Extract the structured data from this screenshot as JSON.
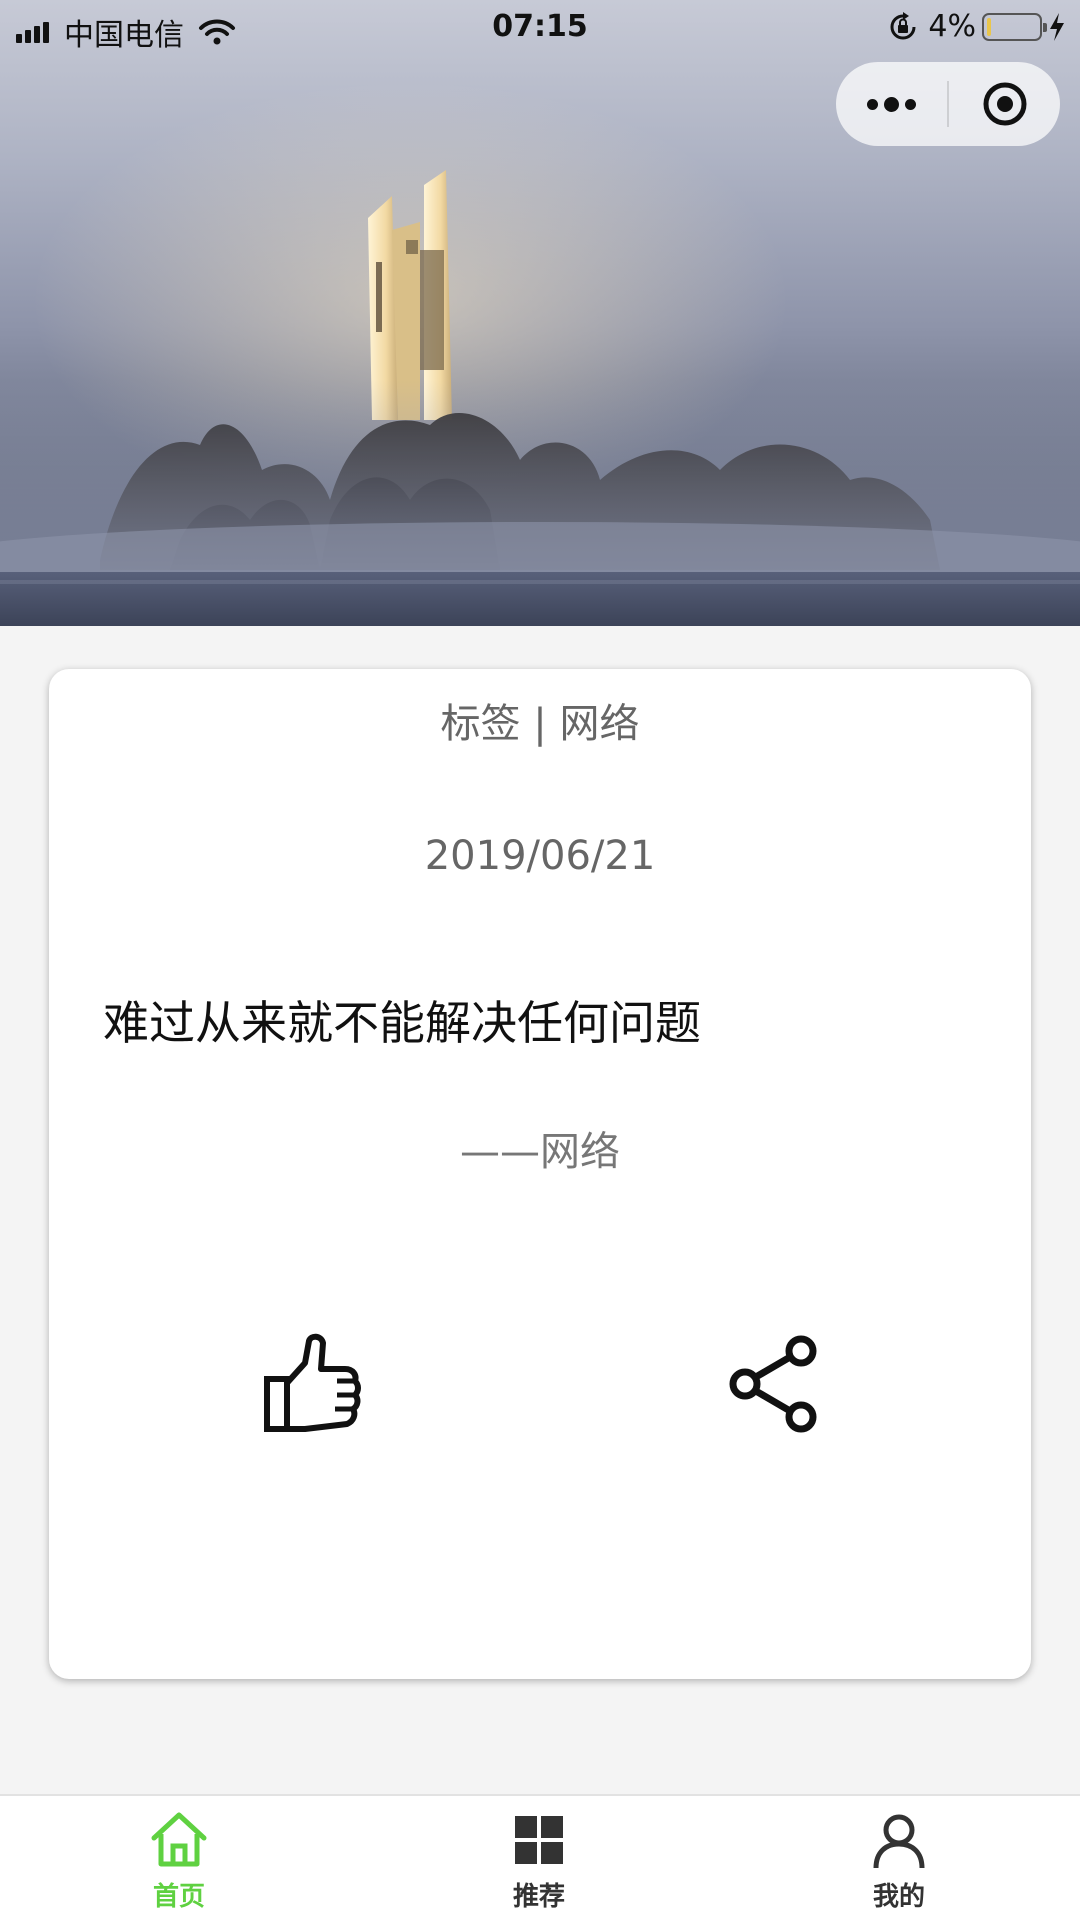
{
  "status_bar": {
    "carrier": "中国电信",
    "time": "07:15",
    "battery_percent": "4%",
    "battery_level": 0.04,
    "icons": [
      "signal-icon",
      "wifi-icon",
      "rotation-lock-icon",
      "battery-icon",
      "charging-icon"
    ]
  },
  "capsule": {
    "icons": [
      "more-dots-icon",
      "close-target-icon"
    ]
  },
  "card": {
    "tag": "标签 | 网络",
    "date": "2019/06/21",
    "quote": "难过从来就不能解决任何问题",
    "author": "——网络",
    "actions": [
      "thumbs-up-icon",
      "share-icon"
    ]
  },
  "tabbar": {
    "tabs": [
      {
        "label": "首页",
        "icon": "home-icon",
        "active": true
      },
      {
        "label": "推荐",
        "icon": "grid-icon",
        "active": false
      },
      {
        "label": "我的",
        "icon": "user-icon",
        "active": false
      }
    ]
  },
  "colors": {
    "active_tab": "#5fd141",
    "page_background": "#f4f4f4"
  }
}
